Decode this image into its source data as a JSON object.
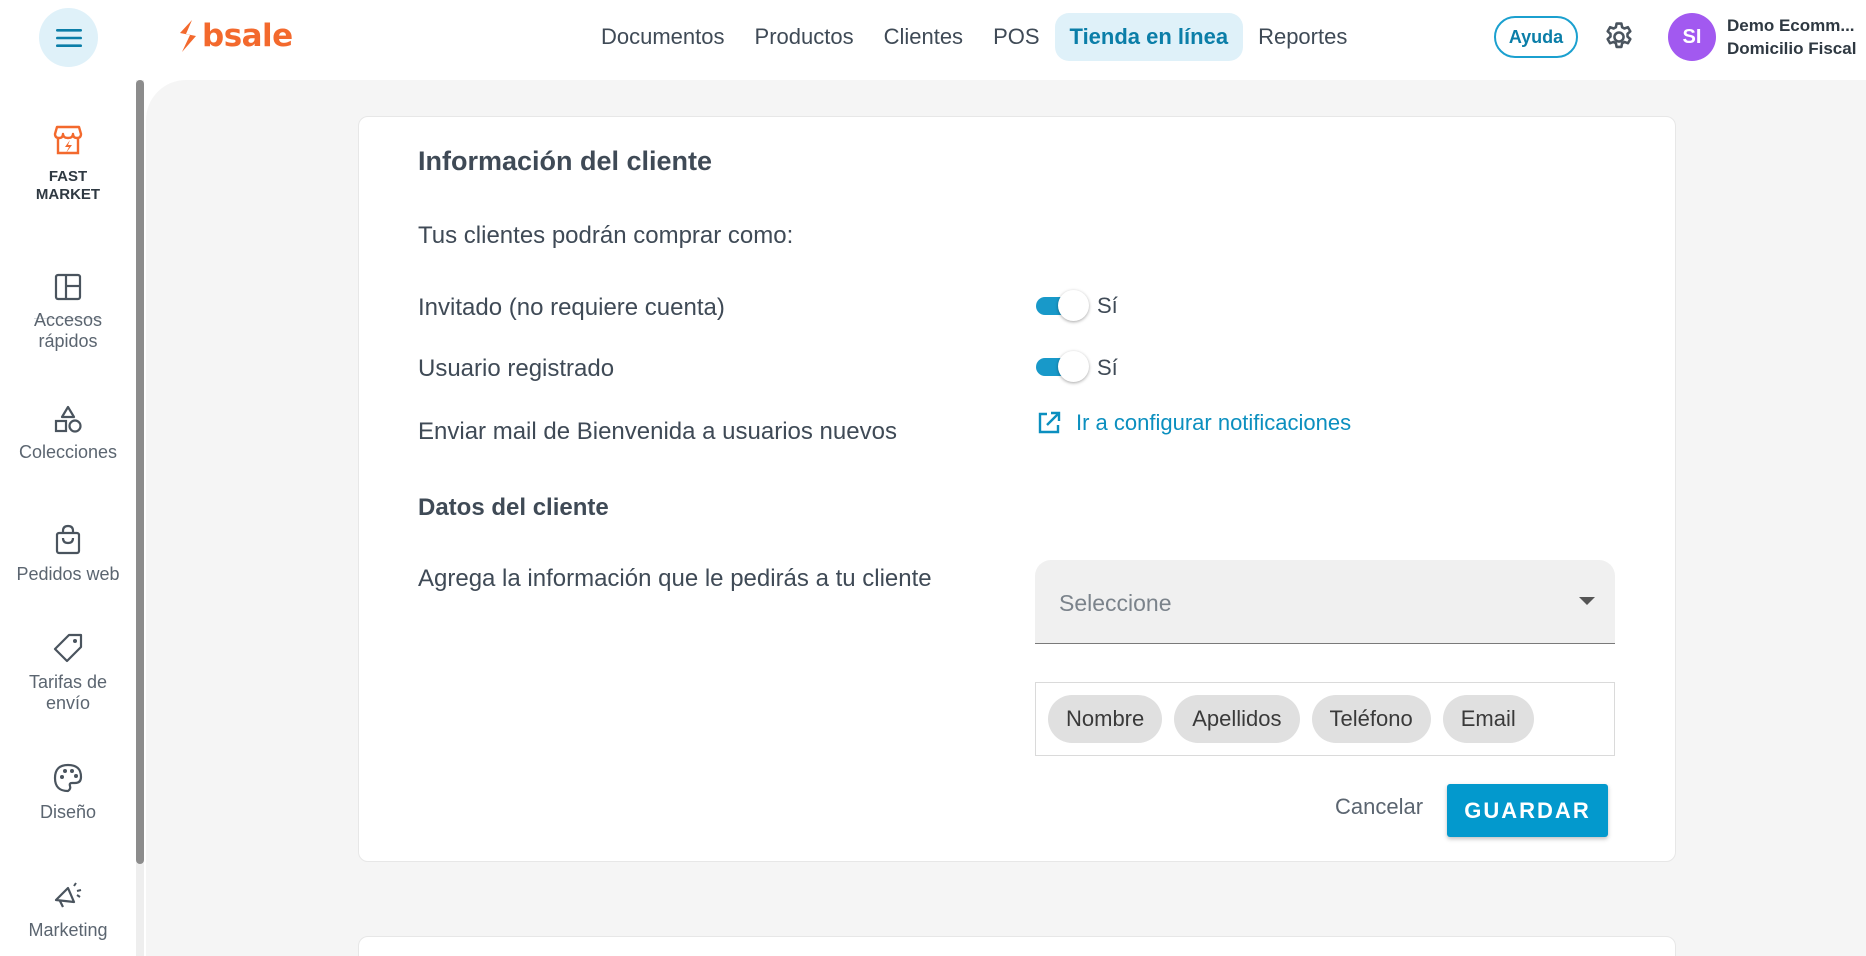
{
  "header": {
    "logo_text": "bsale",
    "nav": [
      {
        "label": "Documentos"
      },
      {
        "label": "Productos"
      },
      {
        "label": "Clientes"
      },
      {
        "label": "POS"
      },
      {
        "label": "Tienda en línea",
        "active": true
      },
      {
        "label": "Reportes"
      }
    ],
    "help_label": "Ayuda",
    "avatar_initials": "SI",
    "user_name": "Demo Ecomm...",
    "user_branch": "Domicilio Fiscal"
  },
  "sidebar": {
    "store": {
      "label_line1": "FAST",
      "label_line2": "MARKET",
      "icon": "store-icon"
    },
    "items": [
      {
        "label_line1": "Accesos",
        "label_line2": "rápidos",
        "icon": "dashboard-icon"
      },
      {
        "label_line1": "Colecciones",
        "label_line2": "",
        "icon": "shapes-icon"
      },
      {
        "label_line1": "Pedidos web",
        "label_line2": "",
        "icon": "shopping-bag-icon"
      },
      {
        "label_line1": "Tarifas de",
        "label_line2": "envío",
        "icon": "tag-icon"
      },
      {
        "label_line1": "Diseño",
        "label_line2": "",
        "icon": "palette-icon"
      },
      {
        "label_line1": "Marketing",
        "label_line2": "",
        "icon": "megaphone-icon"
      }
    ]
  },
  "form": {
    "title": "Información del cliente",
    "buy_as_label": "Tus clientes podrán comprar como:",
    "guest_label": "Invitado (no requiere cuenta)",
    "guest_toggle_text": "Sí",
    "guest_enabled": true,
    "registered_label": "Usuario registrado",
    "registered_toggle_text": "Sí",
    "registered_enabled": true,
    "welcome_mail_label": "Enviar mail de Bienvenida a usuarios nuevos",
    "notifications_link": "Ir a configurar notificaciones",
    "customer_data_title": "Datos del cliente",
    "add_info_label": "Agrega la información que le pedirás a tu cliente",
    "select_placeholder": "Seleccione",
    "chips": [
      "Nombre",
      "Apellidos",
      "Teléfono",
      "Email"
    ],
    "cancel_label": "Cancelar",
    "save_label": "GUARDAR"
  },
  "colors": {
    "accent": "#0399cd",
    "brand": "#f3692d",
    "avatar": "#a259f0"
  }
}
